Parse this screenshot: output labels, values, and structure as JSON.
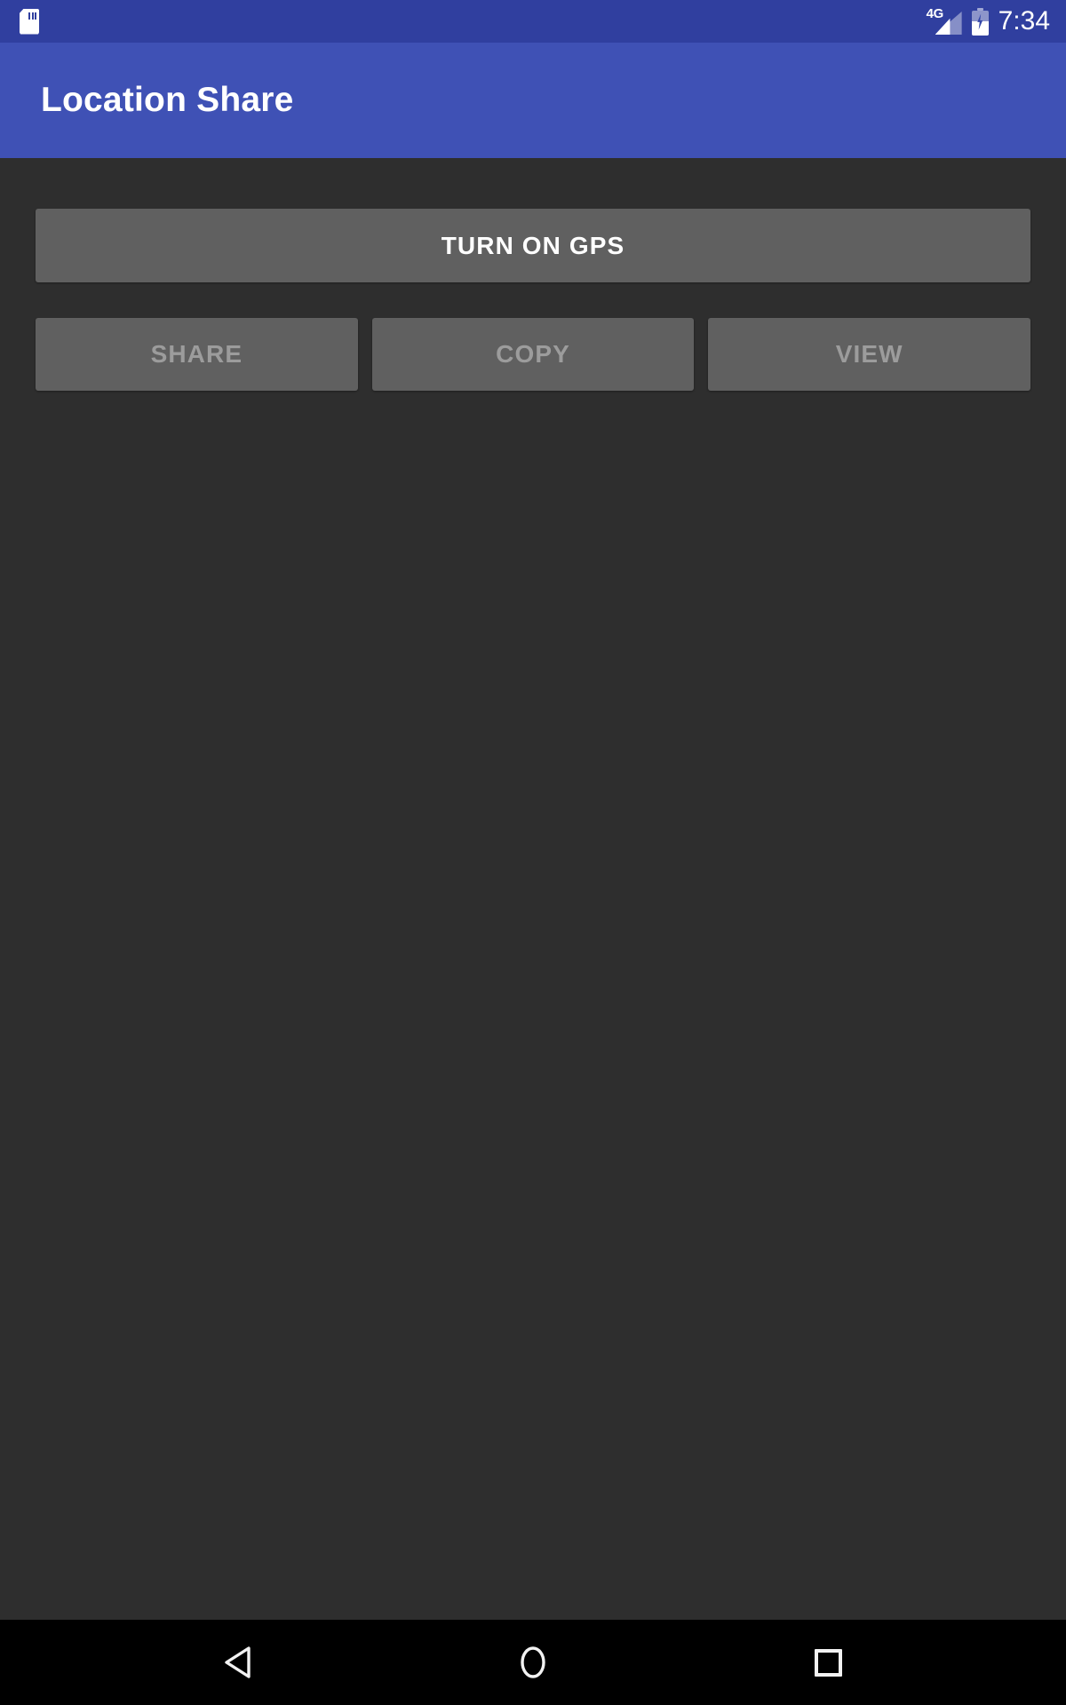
{
  "status_bar": {
    "background_color": "#303f9f",
    "left_icons": [
      {
        "name": "sd-card-icon",
        "label": "SD card"
      }
    ],
    "network_label": "4G",
    "signal_icon": "signal-cellular-icon",
    "battery_icon": "battery-charging-icon",
    "time": "7:34"
  },
  "app_bar": {
    "title": "Location Share",
    "background_color": "#3f51b5",
    "text_color": "#ffffff"
  },
  "content": {
    "background_color": "#2e2e2e",
    "primary_button": {
      "label": "TURN ON GPS",
      "enabled": true,
      "background_color": "#606060",
      "text_color": "#ffffff"
    },
    "action_buttons": [
      {
        "label": "SHARE",
        "enabled": false,
        "background_color": "#606060",
        "text_color": "#9c9c9c"
      },
      {
        "label": "COPY",
        "enabled": false,
        "background_color": "#606060",
        "text_color": "#9c9c9c"
      },
      {
        "label": "VIEW",
        "enabled": false,
        "background_color": "#606060",
        "text_color": "#9c9c9c"
      }
    ]
  },
  "nav_bar": {
    "background_color": "#000000",
    "buttons": [
      {
        "name": "back",
        "icon": "back-triangle-icon"
      },
      {
        "name": "home",
        "icon": "home-circle-icon"
      },
      {
        "name": "recents",
        "icon": "recents-square-icon"
      }
    ]
  }
}
